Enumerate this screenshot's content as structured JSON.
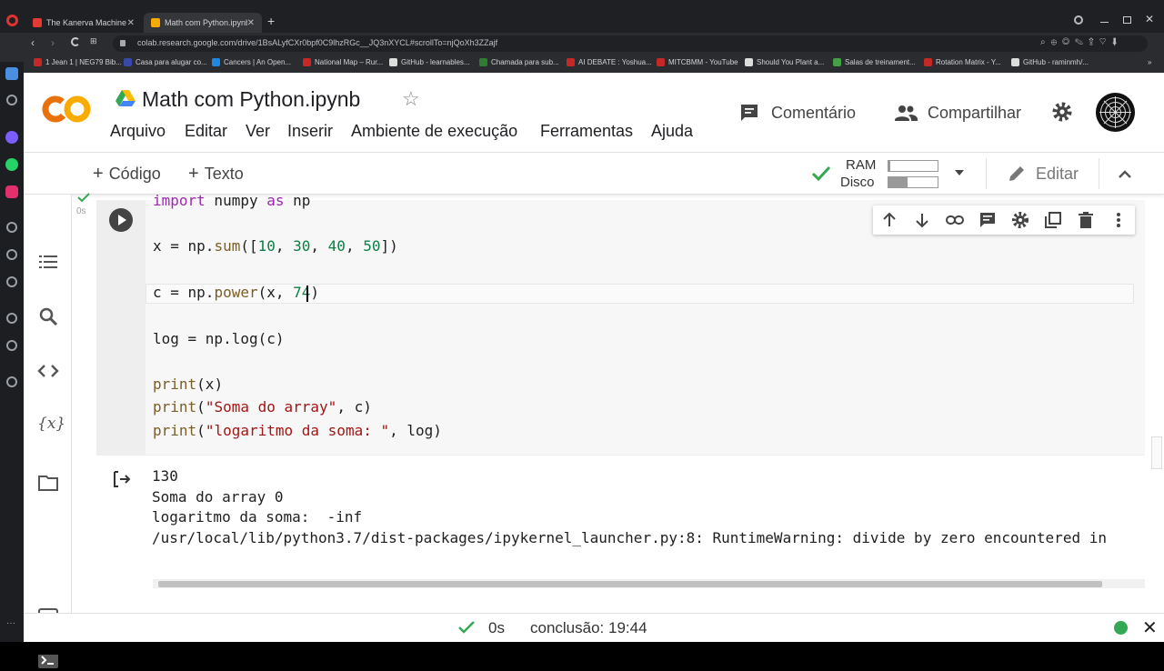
{
  "browser": {
    "tabs": [
      {
        "label": "The Kanerva Machine - Yo",
        "active": false
      },
      {
        "label": "Math com Python.ipynb",
        "active": true
      }
    ],
    "url": "colab.research.google.com/drive/1BsALyfCXr0bpf0C9lhzRGc__JQ3nXYCL#scrollTo=njQoXh3ZZajf",
    "bookmarks": [
      "1 Jean 1 | NEG79 Bib...",
      "Casa para alugar co...",
      "Cancers | An Open...",
      "National Map – Rur...",
      "GitHub - learnables...",
      "Chamada para sub...",
      "AI DEBATE : Yoshua...",
      "MITCBMM - YouTube",
      "Should You Plant a...",
      "Salas de treinament...",
      "Rotation Matrix - Y...",
      "GitHub - raminmh/..."
    ]
  },
  "colab": {
    "logo_text": "CO",
    "title": "Math com Python.ipynb",
    "menu": [
      "Arquivo",
      "Editar",
      "Ver",
      "Inserir",
      "Ambiente de execução",
      "Ferramentas",
      "Ajuda"
    ],
    "comment_label": "Comentário",
    "share_label": "Compartilhar",
    "toolbar": {
      "code_label": "Código",
      "text_label": "Texto",
      "ram_label": "RAM",
      "disk_label": "Disco",
      "edit_label": "Editar"
    },
    "ram_usage": 0.04,
    "disk_usage": 0.38
  },
  "cell": {
    "exec_time": "0s",
    "code_lines": {
      "l1": {
        "a": "import",
        "b": " numpy ",
        "c": "as",
        "d": " np"
      },
      "l2": {
        "a": "x = np.",
        "b": "sum",
        "c": "([",
        "d": "10",
        "e": ", ",
        "f": "30",
        "g": ", ",
        "h": "40",
        "i": ", ",
        "j": "50",
        "k": "])"
      },
      "l3": {
        "a": "c = np.",
        "b": "power",
        "c": "(x, ",
        "d": "74",
        "e": ")"
      },
      "l4": {
        "a": "log = np.log(c)"
      },
      "l5": {
        "a": "print",
        "b": "(x)"
      },
      "l6": {
        "a": "print",
        "b": "(",
        "c": "\"Soma do array\"",
        "d": ", c)"
      },
      "l7": {
        "a": "print",
        "b": "(",
        "c": "\"logaritmo da soma: \"",
        "d": ", log)"
      }
    },
    "output": [
      "130",
      "Soma do array 0",
      "logaritmo da soma:  -inf",
      "/usr/local/lib/python3.7/dist-packages/ipykernel_launcher.py:8: RuntimeWarning: divide by zero encountered in"
    ]
  },
  "status": {
    "time": "0s",
    "completion": "conclusão: 19:44"
  },
  "colors": {
    "colab_orange": "#f9ab00",
    "colab_orange_dark": "#e8710a",
    "success_green": "#34a853",
    "keyword": "#9c27b0",
    "number": "#0b8043",
    "string": "#a31515"
  }
}
